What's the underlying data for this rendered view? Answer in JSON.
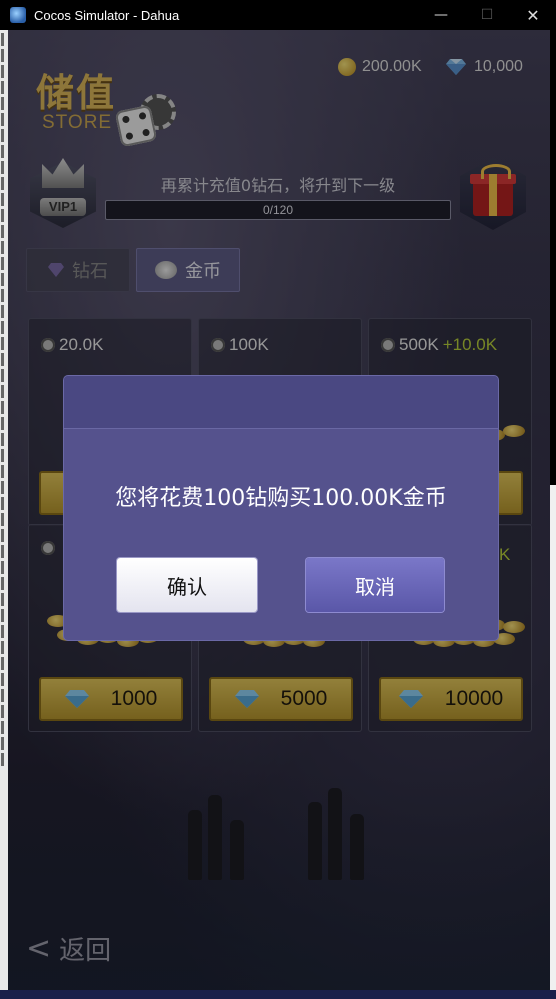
{
  "window": {
    "title": "Cocos Simulator - Dahua",
    "minimize_glyph": "—",
    "maximize_glyph": "☐",
    "close_glyph": "✕"
  },
  "header": {
    "store_cn": "储值",
    "store_en": "STORE",
    "coins": "200.00K",
    "diamonds": "10,000"
  },
  "vip": {
    "level_label": "VIP1",
    "hint": "再累计充值0钻石，将升到下一级",
    "progress_text": "0/120",
    "progress_fraction": 0.0
  },
  "tabs": [
    {
      "label": "钻石",
      "icon": "diamond-icon",
      "selected": false
    },
    {
      "label": "金币",
      "icon": "coin-stack-icon",
      "selected": true
    }
  ],
  "items": [
    {
      "amount": "20.0K",
      "bonus": "",
      "price": ""
    },
    {
      "amount": "100K",
      "bonus": "",
      "price": ""
    },
    {
      "amount": "500K",
      "bonus": "+10.0K",
      "price": ""
    },
    {
      "amount": "",
      "bonus": "",
      "price": "1000"
    },
    {
      "amount": "",
      "bonus": "K",
      "price": "5000"
    },
    {
      "amount": "",
      "bonus": "",
      "price": "10000"
    }
  ],
  "back": {
    "chevron": "<",
    "label": "返回"
  },
  "dialog": {
    "message": "您将花费100钻购买100.00K金币",
    "confirm_label": "确认",
    "cancel_label": "取消"
  },
  "colors": {
    "dialog_bg": "#55528d",
    "gold_button": "#d4b84a",
    "bonus_green": "#b7cf3b"
  }
}
